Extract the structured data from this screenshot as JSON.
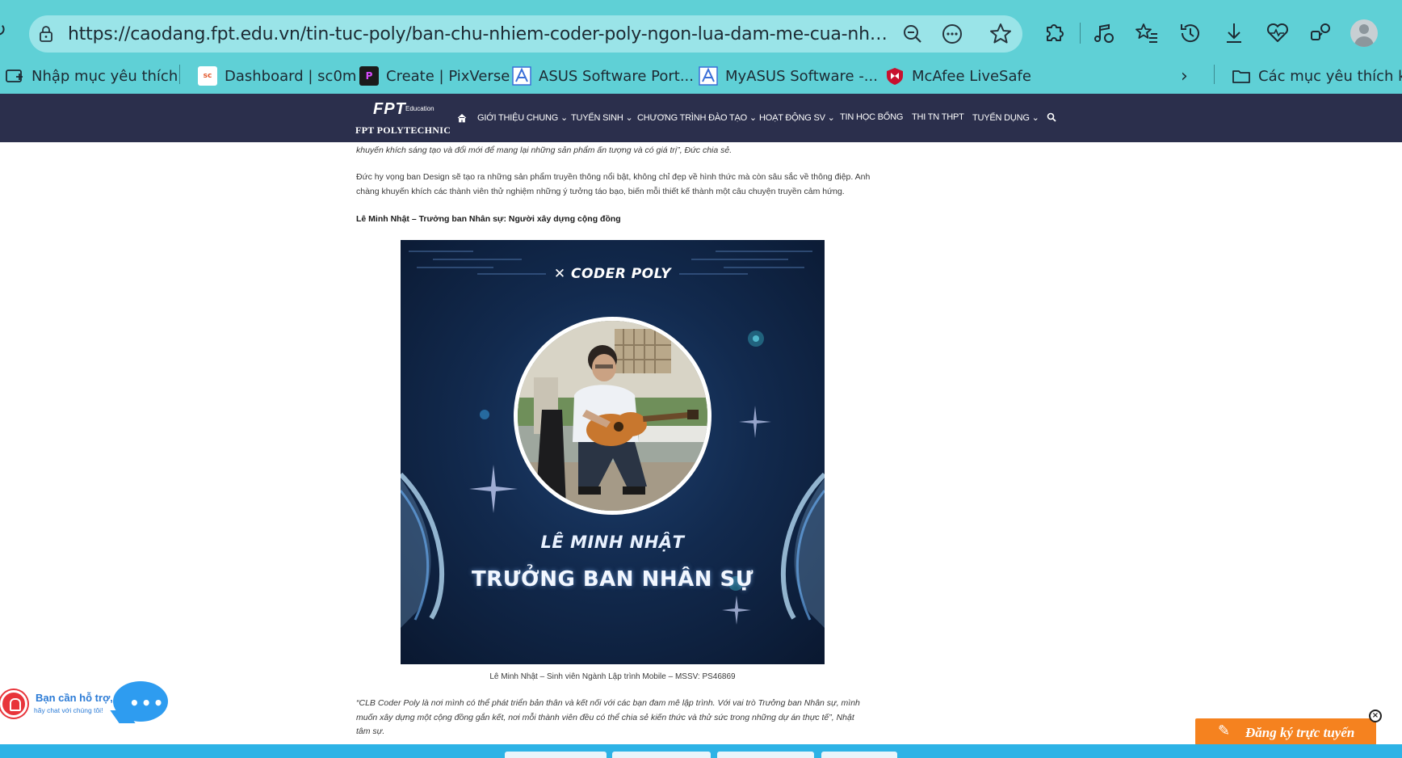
{
  "browser": {
    "url": "https://caodang.fpt.edu.vn/tin-tuc-poly/ban-chu-nhiem-coder-poly-ngon-lua-dam-me-cua-nhung-nguoi-tr...",
    "favorites": [
      {
        "label": "Nhập mục yêu thích",
        "icon": "bookmark-add-icon"
      },
      {
        "label": "Dashboard | sc0m",
        "icon": "sc0m-favicon"
      },
      {
        "label": "Create | PixVerse",
        "icon": "pixverse-favicon"
      },
      {
        "label": "ASUS Software Port...",
        "icon": "asus-favicon"
      },
      {
        "label": "MyASUS Software -...",
        "icon": "asus-favicon"
      },
      {
        "label": "McAfee LiveSafe",
        "icon": "mcafee-favicon"
      }
    ],
    "other_favorites": "Các mục yêu thích khác"
  },
  "site": {
    "logo_fpt": "FPT",
    "logo_edu": "Education",
    "logo_poly": "FPT POLYTECHNIC",
    "nav": [
      "GIỚI THIỆU CHUNG",
      "TUYỂN SINH",
      "CHƯƠNG TRÌNH ĐÀO TẠO",
      "HOẠT ĐỘNG SV",
      "TIN HỌC BỔNG",
      "THI TN THPT",
      "TUYỂN DỤNG"
    ]
  },
  "article": {
    "p0": "khuyến khích sáng tạo và đổi mới để mang lại những sản phẩm ấn tượng và có giá trị”, Đức chia sẻ.",
    "p1": "Đức hy vọng ban Design sẽ tạo ra những sản phẩm truyền thông nổi bật, không chỉ đẹp về hình thức mà còn sâu sắc về thông điệp. Anh chàng khuyến khích các thành viên thử nghiệm những ý tưởng táo bạo, biến mỗi thiết kế thành một câu chuyện truyền cảm hứng.",
    "heading": "Lê Minh Nhật – Trưởng ban Nhân sự: Người xây dựng cộng đồng",
    "poster": {
      "brand": "CODER POLY",
      "name": "LÊ MINH NHẬT",
      "role": "TRƯỞNG BAN NHÂN SỰ"
    },
    "caption": "Lê Minh Nhật – Sinh viên Ngành Lập trình Mobile – MSSV: PS46869",
    "quote": "“CLB Coder Poly là nơi mình có thể phát triển bản thân và kết nối với các bạn đam mê lập trình. Với vai trò Trưởng ban Nhân sự, mình muốn xây dựng một cộng đồng gắn kết, nơi mỗi thành viên đều có thể chia sẻ kiến thức và thử sức trong những dự án thực tế”, Nhật tâm sự."
  },
  "widgets": {
    "support_title": "Bạn cần hỗ trợ,",
    "support_sub": "hãy chat với chúng tôi!",
    "support_dots": "•••",
    "register_label": "Đăng ký trực tuyến"
  },
  "colors": {
    "chrome": "#5fd0d6",
    "nav": "#2b2f4c",
    "register": "#f5821f",
    "bottombar": "#2db3e6"
  }
}
